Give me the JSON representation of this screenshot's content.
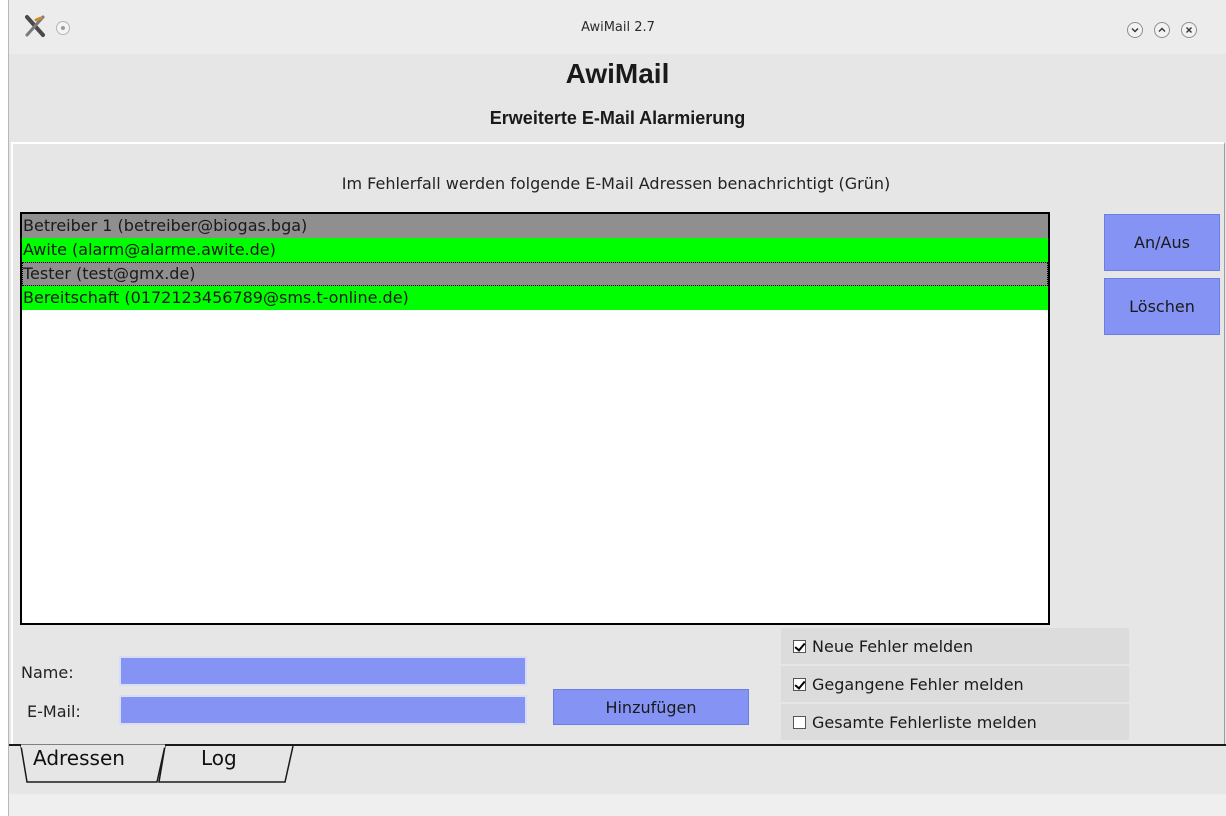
{
  "window": {
    "title": "AwiMail 2.7"
  },
  "header": {
    "title": "AwiMail",
    "subtitle": "Erweiterte E-Mail Alarmierung"
  },
  "main": {
    "info_text": "Im Fehlerfall werden folgende E-Mail Adressen benachrichtigt (Grün)",
    "addresses": [
      {
        "label": "Betreiber 1 (betreiber@biogas.bga)",
        "active": false
      },
      {
        "label": "Awite (alarm@alarme.awite.de)",
        "active": true
      },
      {
        "label": "Tester (test@gmx.de)",
        "active": false
      },
      {
        "label": "Bereitschaft (0172123456789@sms.t-online.de)",
        "active": true
      }
    ],
    "toggle_button": "An/Aus",
    "delete_button": "Löschen"
  },
  "form": {
    "name_label": "Name:",
    "name_value": "",
    "email_label": "E-Mail:",
    "email_value": "",
    "add_button": "Hinzufügen"
  },
  "options": [
    {
      "label": "Neue Fehler melden",
      "checked": true
    },
    {
      "label": "Gegangene Fehler melden",
      "checked": true
    },
    {
      "label": "Gesamte Fehlerliste melden",
      "checked": false
    }
  ],
  "tabs": [
    {
      "label": "Adressen",
      "active": true
    },
    {
      "label": "Log",
      "active": false
    }
  ],
  "colors": {
    "active_row": "#00ff00",
    "inactive_row": "#8f8f8f",
    "button": "#8593f4",
    "window_bg": "#e6e6e6"
  },
  "icons": {
    "app": "app-logo-icon",
    "menu": "window-menu-icon",
    "minimize": "minimize-icon",
    "maximize": "maximize-icon",
    "close": "close-icon"
  }
}
